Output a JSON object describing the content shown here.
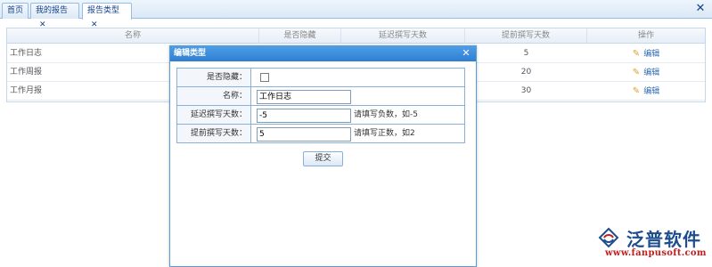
{
  "tabs": [
    {
      "label": "首页",
      "closable": false
    },
    {
      "label": "我的报告",
      "closable": true
    },
    {
      "label": "报告类型",
      "closable": true,
      "active": true
    }
  ],
  "tab_close_glyph": "✕",
  "window_close_glyph": "✕",
  "grid": {
    "columns": [
      "名称",
      "是否隐藏",
      "延迟撰写天数",
      "提前撰写天数",
      "操作"
    ],
    "rows": [
      {
        "name": "工作日志",
        "advance_days": "5",
        "action": "编辑"
      },
      {
        "name": "工作周报",
        "advance_days": "20",
        "action": "编辑"
      },
      {
        "name": "工作月报",
        "advance_days": "30",
        "action": "编辑"
      }
    ]
  },
  "modal": {
    "title": "编辑类型",
    "close_glyph": "✕",
    "fields": {
      "hidden_label": "是否隐藏：",
      "name_label": "名称：",
      "name_value": "工作日志",
      "delay_label": "延迟撰写天数：",
      "delay_value": "-5",
      "delay_hint": "请填写负数，如-5",
      "advance_label": "提前撰写天数：",
      "advance_value": "5",
      "advance_hint": "请填写正数，如2"
    },
    "hidden_checked": false,
    "submit_label": "提交"
  },
  "logo": {
    "name": "泛普软件",
    "url": "www.fanpusoft.com"
  },
  "colors": {
    "accent": "#2e7fd2",
    "link": "#2f6bb2",
    "brand": "#1e4d8f",
    "brand_url": "#c41d1d"
  }
}
